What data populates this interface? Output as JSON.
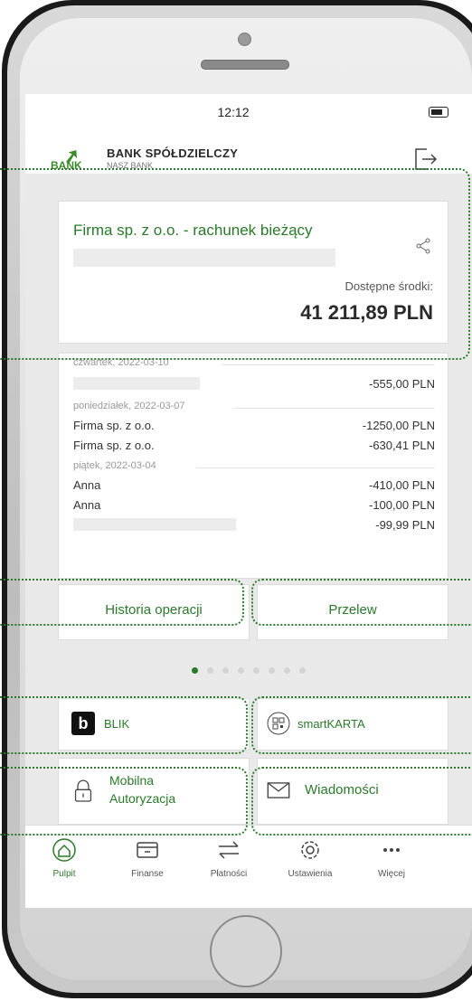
{
  "status_bar": {
    "time": "12:12"
  },
  "header": {
    "bank_name": "BANK SPÓŁDZIELCZY",
    "bank_subtitle": "NASZ BANK",
    "logo_text": "BANK"
  },
  "account": {
    "name": "Firma sp. z o.o. - rachunek bieżący",
    "available_label": "Dostępne środki:",
    "balance": "41 211,89 PLN"
  },
  "transactions": [
    {
      "date": "czwartek, 2022-03-10",
      "items": [
        {
          "name": "",
          "amount": "-555,00 PLN"
        }
      ]
    },
    {
      "date": "poniedziałek, 2022-03-07",
      "items": [
        {
          "name": "Firma sp. z o.o.",
          "amount": "-1250,00 PLN"
        },
        {
          "name": "Firma sp. z o.o.",
          "amount": "-630,41 PLN"
        }
      ]
    },
    {
      "date": "piątek, 2022-03-04",
      "items": [
        {
          "name": "Anna",
          "amount": "-410,00 PLN"
        },
        {
          "name": "Anna",
          "amount": "-100,00 PLN"
        },
        {
          "name": "",
          "amount": "-99,99 PLN"
        }
      ]
    }
  ],
  "actions": {
    "history": "Historia operacji",
    "transfer": "Przelew"
  },
  "pager": {
    "total": 8,
    "active_index": 0
  },
  "tiles": {
    "blik": "BLIK",
    "smartkarta": "smartKARTA",
    "mobile_auth_line1": "Mobilna",
    "mobile_auth_line2": "Autoryzacja",
    "messages": "Wiadomości"
  },
  "tabbar": [
    {
      "label": "Pulpit",
      "icon": "home-icon",
      "active": true
    },
    {
      "label": "Finanse",
      "icon": "wallet-icon",
      "active": false
    },
    {
      "label": "Płatności",
      "icon": "transfer-arrows-icon",
      "active": false
    },
    {
      "label": "Ustawienia",
      "icon": "gear-icon",
      "active": false
    },
    {
      "label": "Więcej",
      "icon": "more-dots-icon",
      "active": false
    }
  ],
  "colors": {
    "brand_green": "#2a7a2a",
    "highlight_dotted": "#2c7a2c"
  }
}
